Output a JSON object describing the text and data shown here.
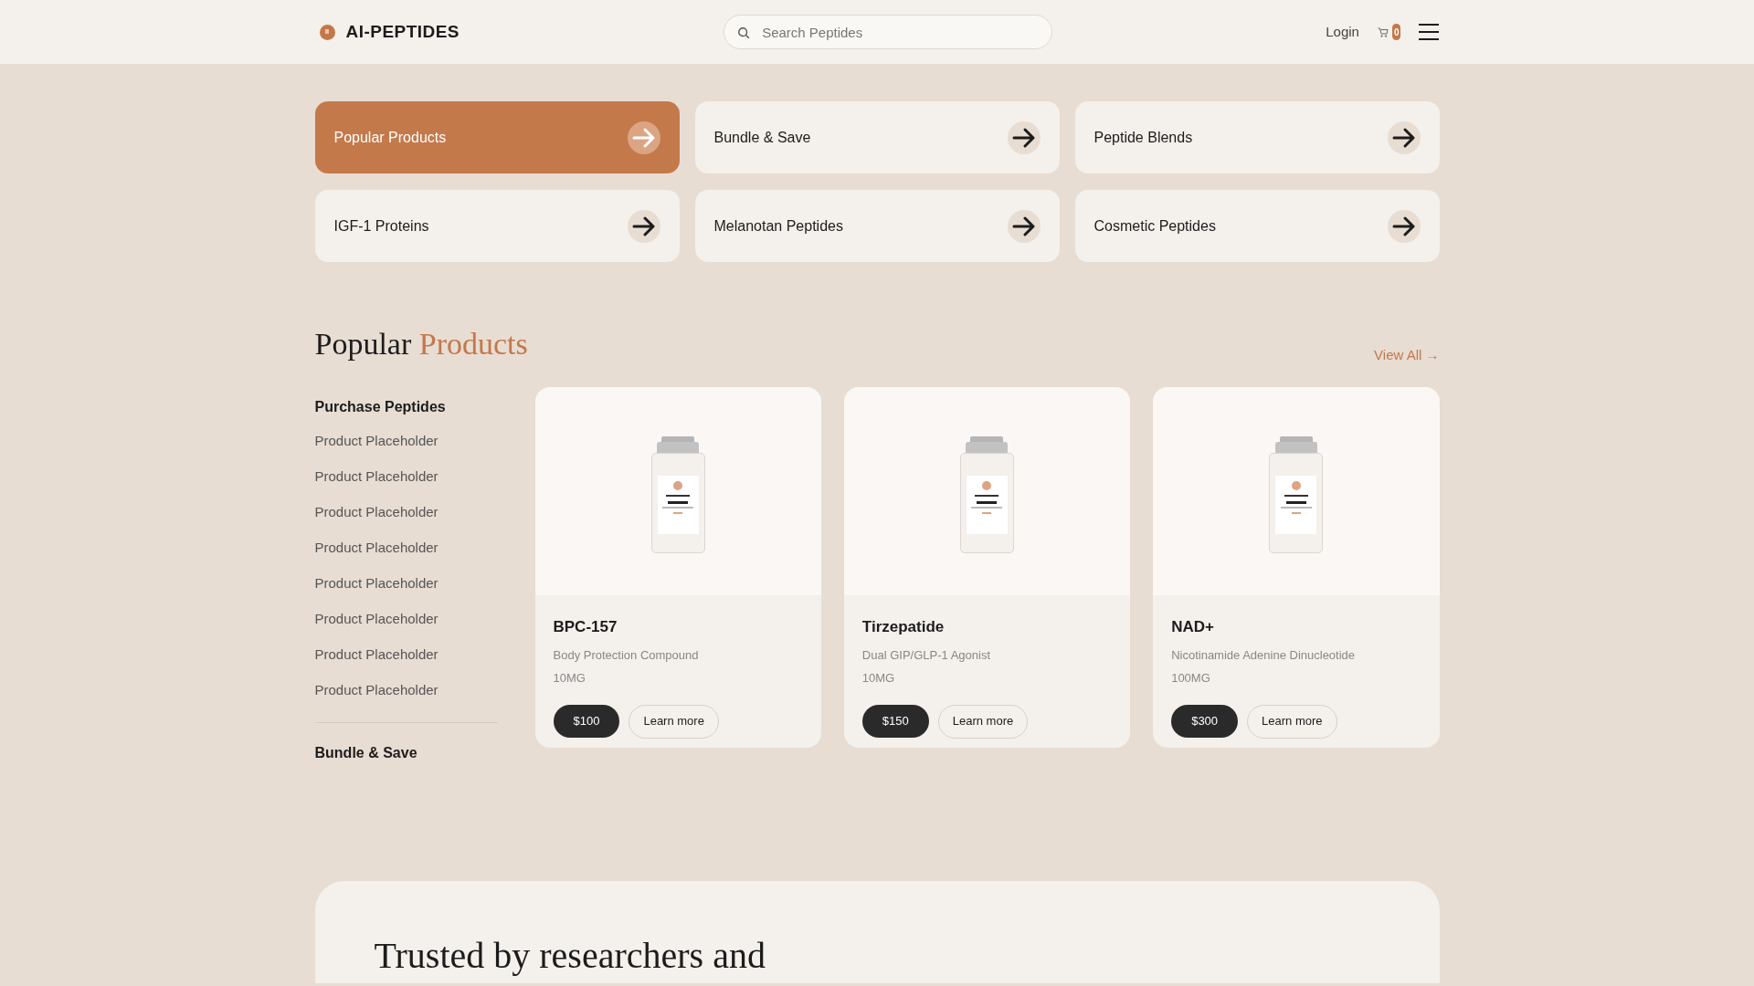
{
  "header": {
    "logo_mark": "II",
    "brand": "AI-PEPTIDES",
    "search": {
      "placeholder": "Search Peptides"
    },
    "login": "Login",
    "cart_count": "0"
  },
  "categories": [
    {
      "label": "Popular Products",
      "selected": true
    },
    {
      "label": "Bundle & Save",
      "selected": false
    },
    {
      "label": "Peptide Blends",
      "selected": false
    },
    {
      "label": "IGF-1 Proteins",
      "selected": false
    },
    {
      "label": "Melanotan Peptides",
      "selected": false
    },
    {
      "label": "Cosmetic Peptides",
      "selected": false
    }
  ],
  "section": {
    "title_plain": "Popular",
    "title_accent": "Products",
    "view_all": "View All →"
  },
  "sidebar": {
    "heading": "Purchase Peptides",
    "items": [
      "Product Placeholder",
      "Product Placeholder",
      "Product Placeholder",
      "Product Placeholder",
      "Product Placeholder",
      "Product Placeholder",
      "Product Placeholder",
      "Product Placeholder"
    ],
    "footer_heading": "Bundle & Save"
  },
  "products": [
    {
      "name": "BPC-157",
      "description": "Body Protection Compound",
      "dose": "10MG",
      "price": "$100",
      "button": "Learn more"
    },
    {
      "name": "Tirzepatide",
      "description": "Dual GIP/GLP-1 Agonist",
      "dose": "10MG",
      "price": "$150",
      "button": "Learn more"
    },
    {
      "name": "NAD+",
      "description": "Nicotinamide Adenine Dinucleotide",
      "dose": "100MG",
      "price": "$300",
      "button": "Learn more"
    }
  ],
  "trust": {
    "heading": "Trusted by researchers and"
  }
}
